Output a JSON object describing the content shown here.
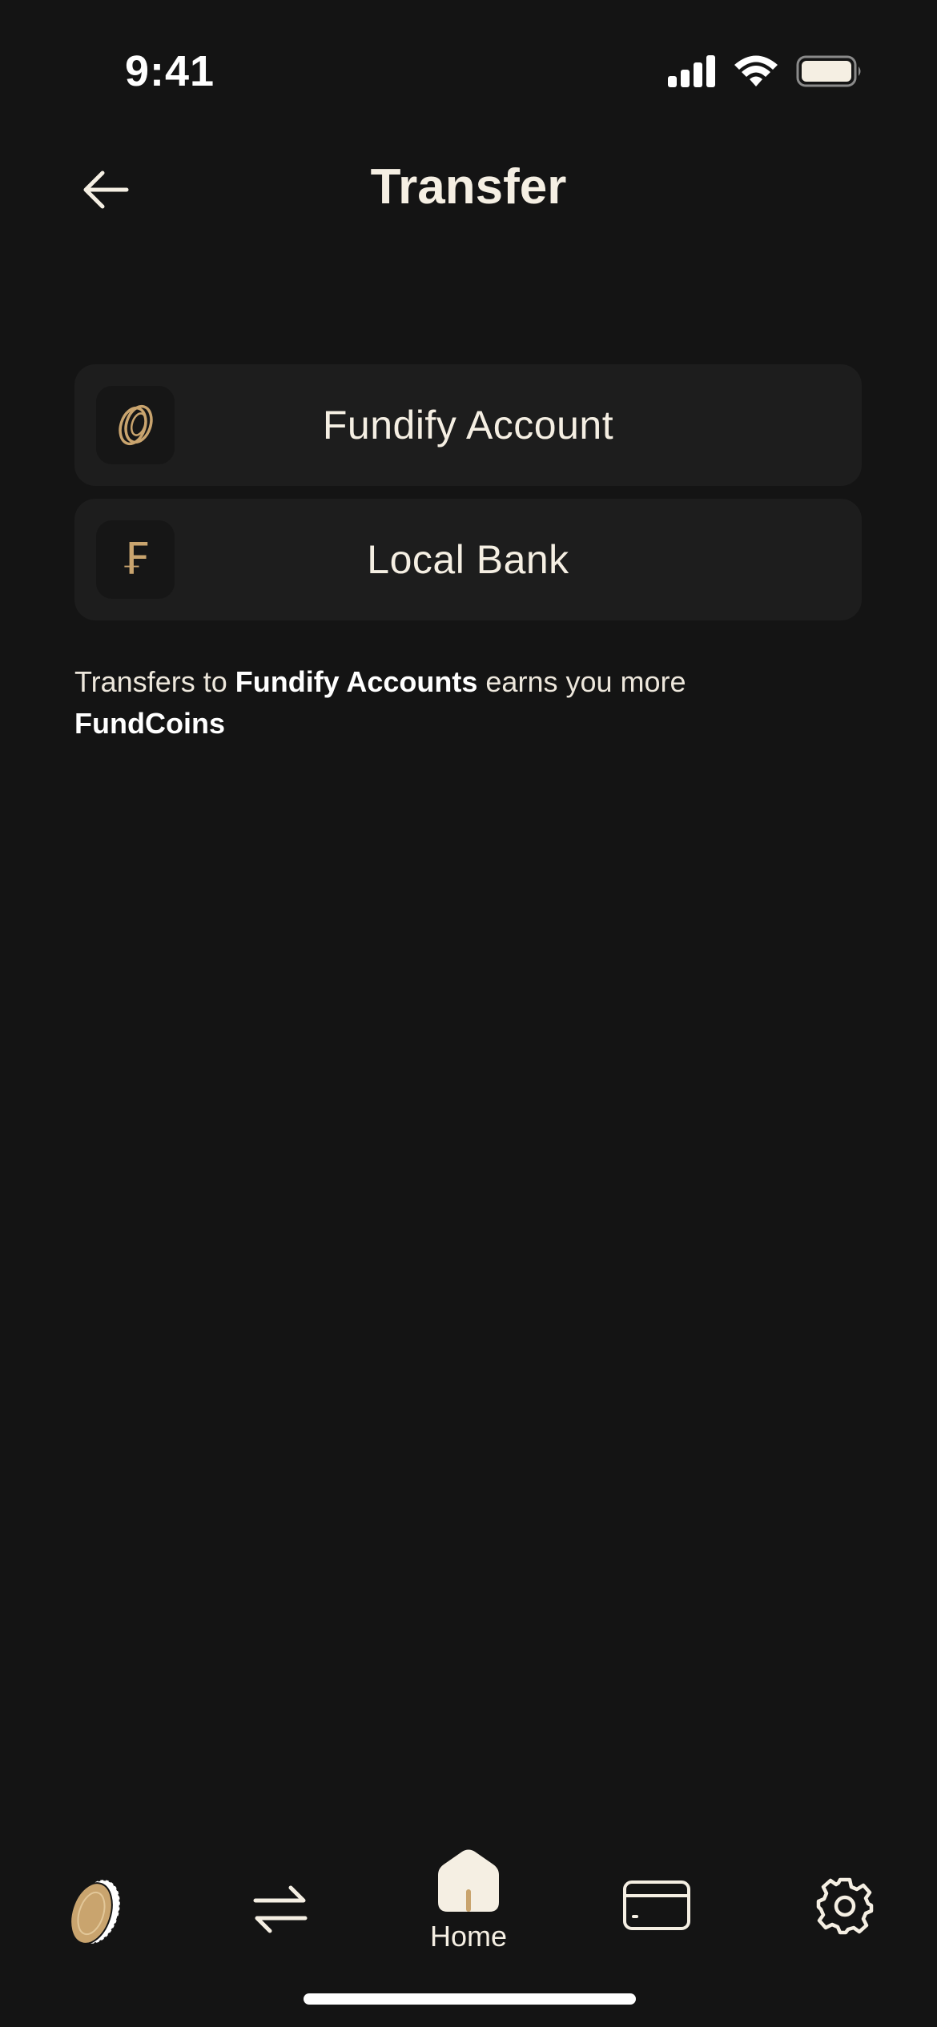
{
  "status_bar": {
    "time": "9:41"
  },
  "header": {
    "title": "Transfer",
    "back_icon": "arrow-left-icon"
  },
  "options": [
    {
      "label": "Fundify Account",
      "icon": "coin-icon"
    },
    {
      "label": "Local Bank",
      "icon": "franc-icon",
      "glyph": "₣"
    }
  ],
  "info": {
    "prefix": "Transfers to ",
    "highlight_1": "Fundify Accounts",
    "middle": " earns you more",
    "highlight_2": "FundCoins"
  },
  "tab_bar": {
    "items": [
      {
        "icon": "fundcoin-icon"
      },
      {
        "icon": "transfer-arrows-icon"
      },
      {
        "icon": "home-icon",
        "label": "Home"
      },
      {
        "icon": "credit-card-icon"
      },
      {
        "icon": "gear-icon"
      }
    ]
  },
  "colors": {
    "background": "#141414",
    "card": "#1D1D1D",
    "accent": "#C9A46E",
    "text": "#F5EFE3"
  }
}
